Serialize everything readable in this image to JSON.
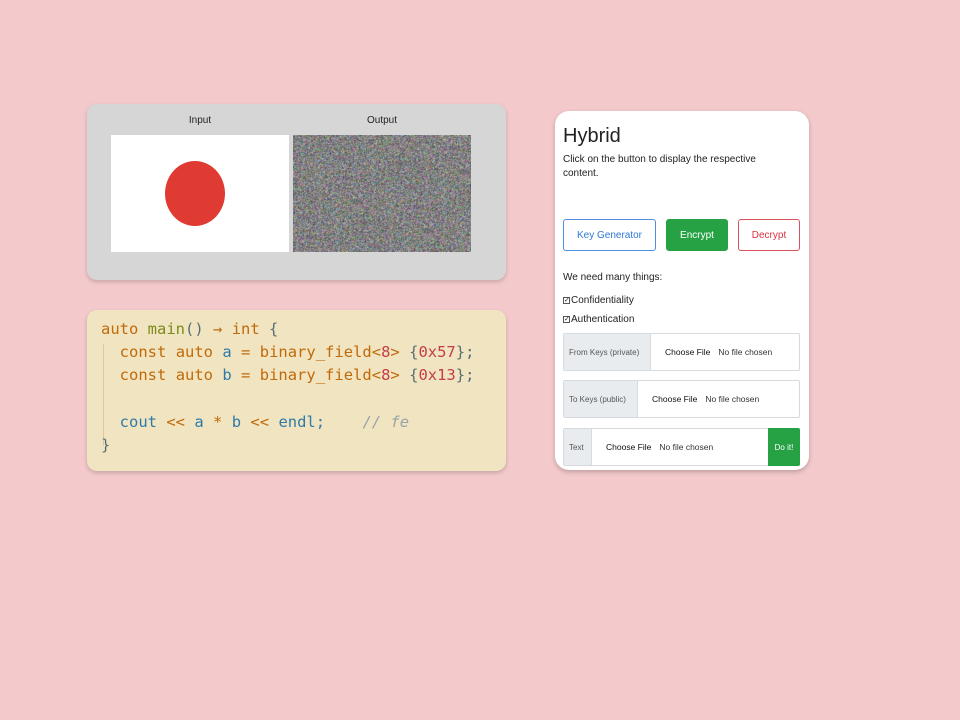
{
  "image_demo": {
    "input_label": "Input",
    "output_label": "Output",
    "colors": {
      "card_bg": "#d6d6d6",
      "dot": "#df3b32"
    }
  },
  "code": {
    "line1": {
      "t1": "auto",
      "t2": "main",
      "t3": "()",
      "t4": "→",
      "t5": "int",
      "t6": "{"
    },
    "line2": {
      "t1": "const",
      "t2": "auto",
      "t3": "a",
      "t4": "=",
      "t5": "binary_field",
      "t6": "<",
      "t7": "8",
      "t8": ">",
      "t9": "{",
      "t10": "0x57",
      "t11": "};"
    },
    "line3": {
      "t1": "const",
      "t2": "auto",
      "t3": "b",
      "t4": "=",
      "t5": "binary_field",
      "t6": "<",
      "t7": "8",
      "t8": ">",
      "t9": "{",
      "t10": "0x13",
      "t11": "};"
    },
    "line5": {
      "t1": "cout",
      "t2": "<<",
      "t3": "a",
      "t4": "*",
      "t5": "b",
      "t6": "<<",
      "t7": "endl;",
      "t8": "// fe"
    },
    "line6": {
      "t1": "}"
    }
  },
  "hybrid": {
    "title": "Hybrid",
    "description": "Click on the button to display the respective content.",
    "buttons": {
      "key_generator": "Key Generator",
      "encrypt": "Encrypt",
      "decrypt": "Decrypt"
    },
    "need_text": "We need many things:",
    "checks": [
      {
        "label": "Confidentiality",
        "checked": true
      },
      {
        "label": "Authentication",
        "checked": true
      }
    ],
    "file_inputs": [
      {
        "prefix": "From Keys (private)",
        "choose": "Choose File",
        "status": "No file chosen"
      },
      {
        "prefix": "To Keys (public)",
        "choose": "Choose File",
        "status": "No file chosen"
      },
      {
        "prefix": "Text",
        "choose": "Choose File",
        "status": "No file chosen",
        "action": "Do it!"
      }
    ],
    "colors": {
      "primary": "#2f78d6",
      "success": "#26a244",
      "danger": "#d9333f"
    }
  },
  "page_colors": {
    "background": "#f3c9cb",
    "code_bg": "#f1e4c0"
  }
}
